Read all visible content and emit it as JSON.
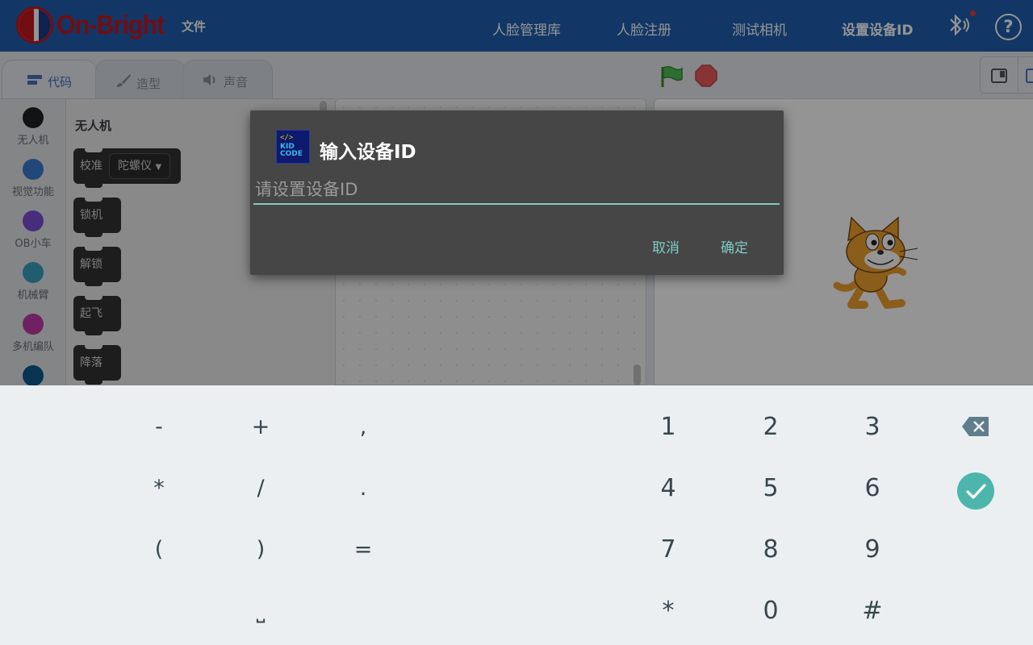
{
  "app": {
    "brand": "On-Bright",
    "file_menu": "文件"
  },
  "nav": [
    "人脸管理库",
    "人脸注册",
    "测试相机",
    "设置设备ID"
  ],
  "tabs": [
    {
      "label": "代码",
      "active": true
    },
    {
      "label": "造型",
      "active": false
    },
    {
      "label": "声音",
      "active": false
    }
  ],
  "categories": [
    {
      "label": "无人机",
      "color": "#222222"
    },
    {
      "label": "视觉功能",
      "color": "#3a7bd5"
    },
    {
      "label": "OB小车",
      "color": "#7a4fd6"
    },
    {
      "label": "机械臂",
      "color": "#3aa0c0"
    },
    {
      "label": "多机编队",
      "color": "#c03aa8"
    },
    {
      "label": "",
      "color": "#0b5a8c"
    }
  ],
  "palette": {
    "title": "无人机",
    "blocks": [
      {
        "label": "校准",
        "dropdown": "陀螺仪"
      },
      {
        "label": "锁机"
      },
      {
        "label": "解锁"
      },
      {
        "label": "起飞"
      },
      {
        "label": "降落"
      }
    ]
  },
  "dialog": {
    "app_icon_text_1": "</>",
    "app_icon_text_2": "KID CODE",
    "title": "输入设备ID",
    "placeholder": "请设置设备ID",
    "value": "",
    "cancel": "取消",
    "ok": "确定"
  },
  "keyboard": {
    "symbols": [
      [
        "-",
        "+",
        ","
      ],
      [
        "*",
        "/",
        "."
      ],
      [
        "(",
        ")",
        "="
      ],
      [
        "",
        "⎵",
        ""
      ]
    ],
    "digits": [
      [
        "1",
        "2",
        "3"
      ],
      [
        "4",
        "5",
        "6"
      ],
      [
        "7",
        "8",
        "9"
      ],
      [
        "*",
        "0",
        "#"
      ]
    ],
    "accent": "#4db6ac"
  }
}
